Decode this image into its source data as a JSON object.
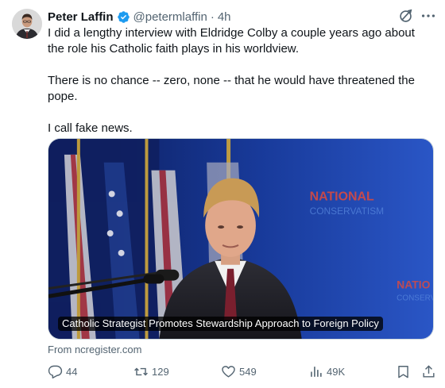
{
  "post": {
    "author_name": "Peter Laffin",
    "handle": "@petermlaffin",
    "separator": "·",
    "time": "4h",
    "paragraphs": [
      "I did a lengthy interview with Eldridge Colby a couple years ago about the role his Catholic faith plays in his worldview.",
      "There is no chance -- zero, none -- that he would have threatened the pope.",
      "I call fake news."
    ],
    "verified_color": "#1d9bf0"
  },
  "card": {
    "caption": "Catholic Strategist Promotes Stewardship Approach to Foreign Policy",
    "source": "From ncregister.com",
    "image_description_icon": "photo-of-speaker-at-podium"
  },
  "actions": {
    "replies": "44",
    "reposts": "129",
    "likes": "549",
    "views": "49K"
  },
  "colors": {
    "text": "#0f1419",
    "muted": "#536471",
    "accent": "#1d9bf0"
  }
}
